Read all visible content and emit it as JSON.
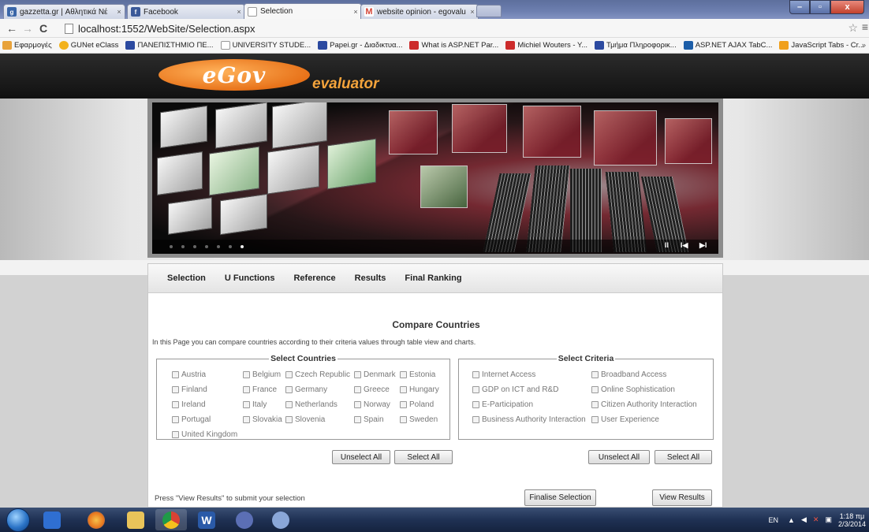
{
  "browser": {
    "tabs": [
      {
        "title": "gazzetta.gr | Αθλητικά Νέ",
        "favicon": "gazzetta-icon",
        "color": "#3a66a8"
      },
      {
        "title": "Facebook",
        "favicon": "facebook-icon",
        "color": "#3b5998"
      },
      {
        "title": "Selection",
        "favicon": "page-icon",
        "color": "#cccccc"
      },
      {
        "title": "website opinion - egovalu",
        "favicon": "gmail-icon",
        "color": "#d44638"
      }
    ],
    "close_glyph": "×",
    "window_controls": {
      "minimize": "–",
      "maximize": "▫",
      "close": "x"
    },
    "nav": {
      "back": "←",
      "forward": "→",
      "reload": "C"
    },
    "url": "localhost:1552/WebSite/Selection.aspx",
    "star": "☆",
    "menu": "≡"
  },
  "bookmarks": [
    {
      "label": "Εφαρμογές",
      "color": "#e8a23a"
    },
    {
      "label": "GUNet eClass",
      "color": "#f3b21c"
    },
    {
      "label": "ΠΑΝΕΠΙΣΤΗΜΙΟ ΠΕ...",
      "color": "#2c4aa0"
    },
    {
      "label": "UNIVERSITY STUDE...",
      "color": "#bbbbbb"
    },
    {
      "label": "Papei.gr - Διαδικτυα...",
      "color": "#2c4aa0"
    },
    {
      "label": "What is ASP.NET Par...",
      "color": "#cc2b2b"
    },
    {
      "label": "Michiel Wouters - Y...",
      "color": "#cc2b2b"
    },
    {
      "label": "Τμήμα Πληροφορικ...",
      "color": "#2c4aa0"
    },
    {
      "label": "ASP.NET AJAX TabC...",
      "color": "#1d5ea8"
    },
    {
      "label": "JavaScript Tabs - Cr...",
      "color": "#f0a01c"
    }
  ],
  "bookmarks_overflow": "»",
  "site": {
    "logo_text": "eGov",
    "logo_suffix": "evaluator",
    "slider": {
      "slide_count": 7,
      "active_slide": 7,
      "controls": [
        "II",
        "I◀",
        "▶I"
      ]
    },
    "menu": [
      "Selection",
      "U Functions",
      "Reference",
      "Results",
      "Final Ranking"
    ],
    "title": "Compare Countries",
    "intro": "In this Page you can compare countries according to their criteria values through table view and charts.",
    "countries": {
      "legend": "Select Countries",
      "items": [
        "Austria",
        "Belgium",
        "Czech Republic",
        "Denmark",
        "Estonia",
        "Finland",
        "France",
        "Germany",
        "Greece",
        "Hungary",
        "Ireland",
        "Italy",
        "Netherlands",
        "Norway",
        "Poland",
        "Portugal",
        "Slovakia",
        "Slovenia",
        "Spain",
        "Sweden",
        "United Kingdom"
      ],
      "unselect": "Unselect All",
      "select": "Select All"
    },
    "criteria": {
      "legend": "Select Criteria",
      "items": [
        "Internet Access",
        "Broadband Access",
        "GDP on ICT and R&D",
        "Online Sophistication",
        "E-Participation",
        "Citizen Authority Interaction",
        "Business Authority Interaction",
        "User Experience"
      ],
      "unselect": "Unselect All",
      "select": "Select All"
    },
    "hint": "Press \"View Results\" to submit your selection",
    "finalise": "Finalise Selection",
    "view_results": "View Results"
  },
  "taskbar": {
    "apps": [
      {
        "name": "media-center-icon",
        "color": "#2f6fd1"
      },
      {
        "name": "firefox-icon",
        "color": "#e8771e"
      },
      {
        "name": "file-explorer-icon",
        "color": "#e9c45a"
      },
      {
        "name": "chrome-icon",
        "color": "#d94234"
      },
      {
        "name": "word-icon",
        "color": "#2a5aa8"
      },
      {
        "name": "infinity-app-icon",
        "color": "#5b6fb5"
      },
      {
        "name": "paint-icon",
        "color": "#8aa7d8"
      }
    ],
    "lang": "EN",
    "time": "1:18 πμ",
    "date": "2/3/2014"
  }
}
